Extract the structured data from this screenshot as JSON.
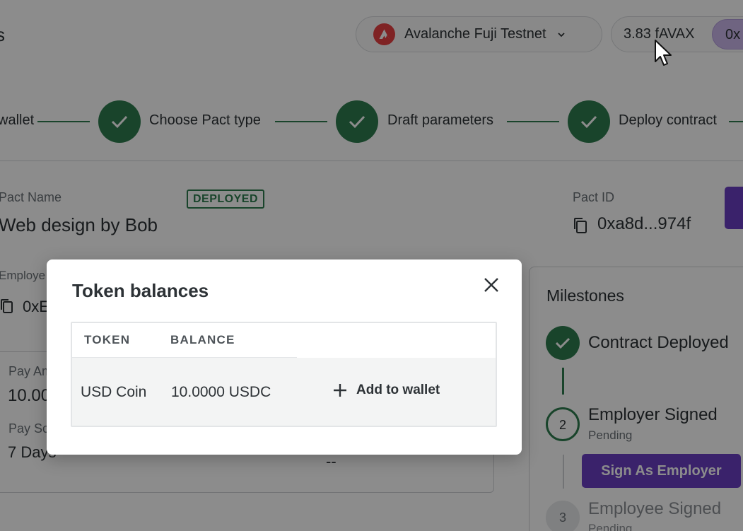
{
  "header": {
    "title_fragment": "s",
    "network": {
      "label": "Avalanche Fuji Testnet",
      "icon": "avalanche-logo-icon",
      "color": "#e84142"
    },
    "balance": "3.83 fAVAX",
    "address_fragment": "0x"
  },
  "stepper": {
    "steps": [
      {
        "label": "wallet"
      },
      {
        "label": "Choose Pact type"
      },
      {
        "label": "Draft parameters"
      },
      {
        "label": "Deploy contract"
      }
    ]
  },
  "pact": {
    "name_label": "Pact Name",
    "name": "Web design by Bob",
    "status_badge": "DEPLOYED",
    "id_label": "Pact ID",
    "id": "0xa8d...974f",
    "employee_label_fragment": "Employe",
    "employee_address_fragment": "0xE",
    "pay_amount_label_fragment": "Pay Am",
    "pay_amount_fragment": "10.00",
    "pay_schedule_label_fragment": "Pay Sc",
    "pay_schedule_fragment": "7 Days",
    "other_value": "--"
  },
  "milestones": {
    "title": "Milestones",
    "items": [
      {
        "name": "Contract Deployed",
        "status": "done"
      },
      {
        "number": "2",
        "name": "Employer Signed",
        "status": "Pending",
        "action": "Sign As Employer"
      },
      {
        "number": "3",
        "name": "Employee Signed",
        "status": "Pending"
      }
    ]
  },
  "modal": {
    "title": "Token balances",
    "table": {
      "headers": [
        "TOKEN",
        "BALANCE"
      ],
      "rows": [
        {
          "token": "USD Coin",
          "balance": "10.0000 USDC",
          "action": "Add to wallet"
        }
      ]
    }
  },
  "colors": {
    "accent_green": "#2e7d4f",
    "accent_purple": "#6b3fc4",
    "overlay": "rgba(0,0,0,0.45)"
  }
}
